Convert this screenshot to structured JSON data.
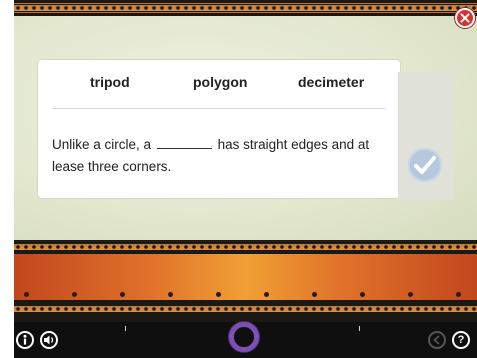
{
  "activity": {
    "word_choices": [
      "tripod",
      "polygon",
      "decimeter"
    ],
    "sentence_before": "Unlike a circle, a",
    "sentence_after": "has straight edges and at lease three corners."
  },
  "controls": {
    "close_icon": "close-icon",
    "check_icon": "checkmark-icon",
    "info_icon": "info-icon",
    "sound_icon": "speaker-icon",
    "back_icon": "back-arrow-icon",
    "help_icon": "question-icon",
    "help_label": "?"
  },
  "colors": {
    "canvas": "#e3e8cf",
    "close_button": "#d8322f",
    "check_button": "#b6c8de",
    "progress_ring": "#7b4fb3"
  }
}
